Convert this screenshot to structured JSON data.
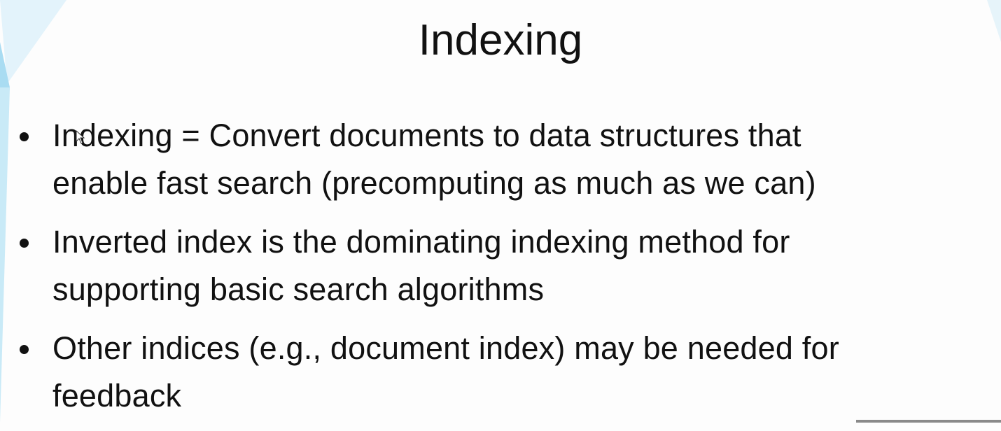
{
  "slide": {
    "title": "Indexing",
    "bullets": [
      {
        "lines": [
          "Indexing = Convert documents to data structures that",
          "enable fast search (precomputing as much as we can)"
        ]
      },
      {
        "lines": [
          "Inverted index is the dominating indexing method for",
          "supporting basic search algorithms"
        ]
      },
      {
        "lines": [
          "Other indices (e.g., document index) may be needed for",
          "feedback"
        ]
      }
    ]
  },
  "colors": {
    "accent": "#9fd8f0",
    "background": "#fdfdfd",
    "text": "#111111"
  }
}
